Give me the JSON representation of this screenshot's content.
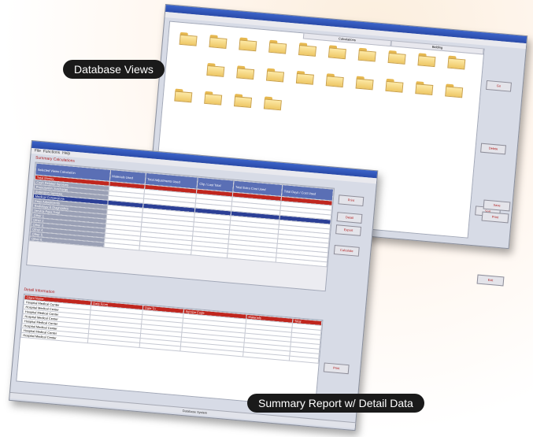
{
  "callouts": {
    "database_views": "Database Views",
    "summary_report": "Summary Report w/ Detail Data"
  },
  "colors": {
    "title_blue": "#2a4aa8",
    "accent_red": "#c0261e",
    "folder_yellow": "#eec765",
    "callout_bg": "#1a1a1a"
  },
  "back_window": {
    "section_headers": [
      "Calculations",
      "Bidding"
    ],
    "folder_icon": "folder-icon",
    "buttons": [
      "Go",
      "Delete",
      "Sort",
      "Print",
      "Exit"
    ]
  },
  "front_window": {
    "menu": [
      "File",
      "Functions",
      "Help"
    ],
    "upper_title": "Summary Calculations",
    "columns": [
      "Selected Views Calculation",
      "Materials Used",
      "Total Adjustments Used",
      "Clip / Last Total",
      "Total Extra Cost Used",
      "Total Days / Cost Used"
    ],
    "row_labels": [
      "Total Money",
      "Cash Related Services",
      "Prescription Surcharge",
      "Extension Services",
      "Medical Conversions",
      "Fees Adjustments",
      "Radiology & Diagnostics",
      "Service Fees Total",
      "Other 1",
      "Other 2",
      "Other 3",
      "Other 4",
      "Other 5",
      "Other 6"
    ],
    "buttons": [
      "Print",
      "Detail",
      "Export",
      "Calculate"
    ],
    "side_buttons": [
      "Save",
      "Print",
      "Exit"
    ],
    "lower_title": "Detail Information",
    "lower_columns": [
      "Client Name",
      "Date From",
      "Date To",
      "Service Code",
      "Materials",
      "Total"
    ],
    "lower_rows": [
      "Hospital Medical Center",
      "Hospital Medical Center",
      "Hospital Medical Center",
      "Hospital Medical Center",
      "Hospital Medical Center",
      "Hospital Medical Center",
      "Hospital Medical Center",
      "Hospital Medical Center"
    ],
    "lower_button": "Print",
    "status": "Database System"
  }
}
